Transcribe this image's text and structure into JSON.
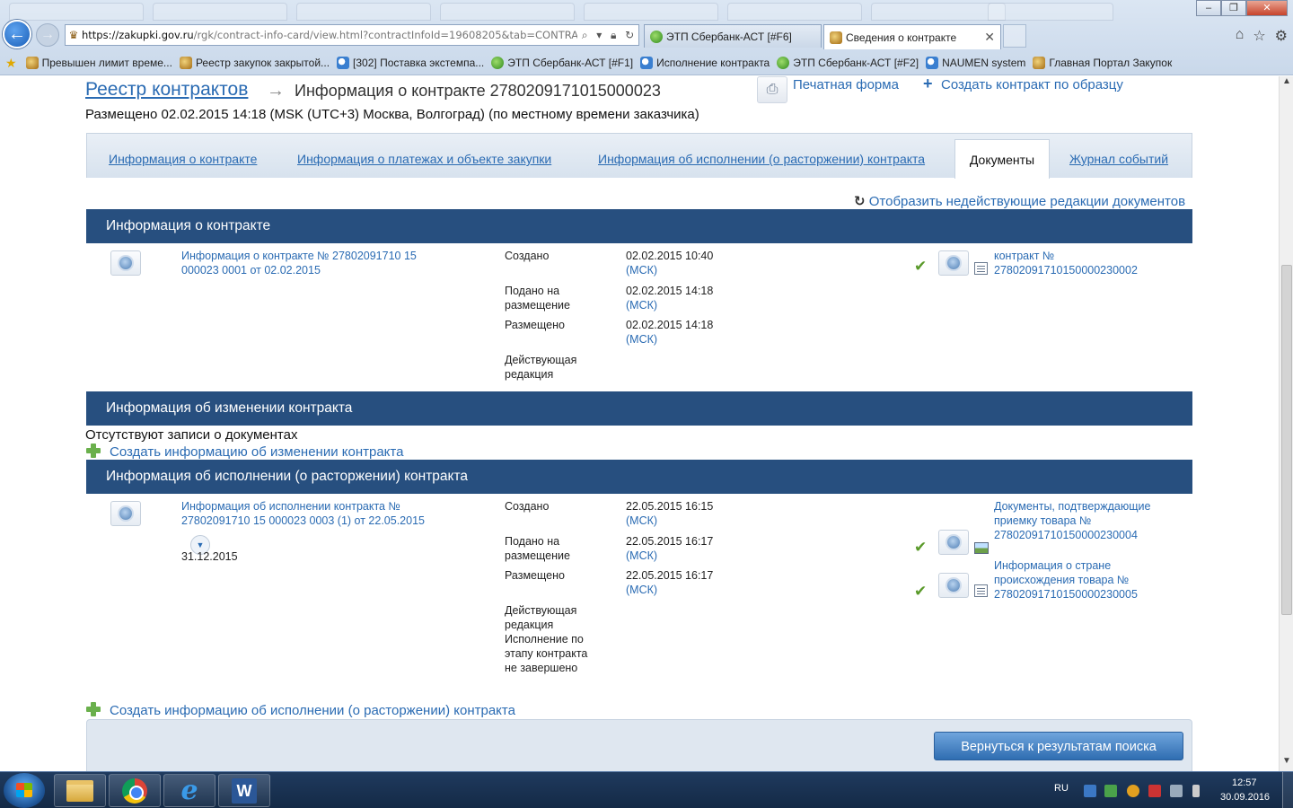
{
  "browser": {
    "url_domain": "https://zakupki.gov.ru",
    "url_path": "/rgk/contract-info-card/view.html?contractInfoId=19608205&tab=CONTRACT_I",
    "tabs": [
      {
        "label": "ЭТП Сбербанк-АСТ [#F6]",
        "icon": "green-globe-icon"
      },
      {
        "label": "Сведения о контракте",
        "icon": "eagle-emblem-icon",
        "active": true
      }
    ],
    "favorites": [
      "Превышен лимит време...",
      "Реестр закупок закрытой...",
      "[302] Поставка экстемпа...",
      "ЭТП Сбербанк-АСТ [#F1]",
      "Исполнение контракта",
      "ЭТП Сбербанк-АСТ [#F2]",
      "NAUMEN system",
      "Главная Портал Закупок"
    ]
  },
  "header": {
    "breadcrumb_root": "Реестр контрактов",
    "breadcrumb_current": "Информация о контракте 2780209171015000023",
    "print_label": "Печатная форма",
    "create_copy_label": "Создать контракт по образцу",
    "placement_info": "Размещено 02.02.2015 14:18 (MSK (UTC+3) Москва, Волгоград) (по местному времени заказчика)"
  },
  "tabs": {
    "contract_info": "Информация о контракте",
    "payments": "Информация о платежах и объекте закупки",
    "execution": "Информация об исполнении (о расторжении) контракта",
    "documents": "Документы",
    "journal": "Журнал событий"
  },
  "show_inactive_label": "Отобразить недействующие редакции документов",
  "sections": {
    "contract": {
      "title": "Информация о контракте",
      "doc_link": "Информация о контракте № 27802091710 15 000023 0001 от 02.02.2015",
      "rows": [
        {
          "label": "Создано",
          "value": "02.02.2015 10:40",
          "tz": "(МСК)"
        },
        {
          "label": "Подано на размещение",
          "value": "02.02.2015 14:18",
          "tz": "(МСК)"
        },
        {
          "label": "Размещено",
          "value": "02.02.2015 14:18",
          "tz": "(МСК)"
        },
        {
          "label": "Действующая редакция"
        }
      ],
      "attachment": "контракт № 27802091710150000230002"
    },
    "change": {
      "title": "Информация об изменении контракта",
      "empty_text": "Отсутствуют записи о документах",
      "create_link": "Создать информацию об изменении контракта"
    },
    "execution": {
      "title": "Информация об исполнении (о расторжении) контракта",
      "doc_link": "Информация об исполнении контракта № 27802091710 15 000023 0003 (1) от 22.05.2015",
      "date": "31.12.2015",
      "rows": [
        {
          "label": "Создано",
          "value": "22.05.2015 16:15",
          "tz": "(МСК)"
        },
        {
          "label": "Подано на размещение",
          "value": "22.05.2015 16:17",
          "tz": "(МСК)"
        },
        {
          "label": "Размещено",
          "value": "22.05.2015 16:17",
          "tz": "(МСК)"
        },
        {
          "label": "Действующая редакция Исполнение по этапу контракта не завершено"
        }
      ],
      "attachment_1": "Документы, подтверждающие приемку товара № 27802091710150000230004",
      "attachment_2": "Информация о стране происхождения товара № 27802091710150000230005",
      "create_link": "Создать информацию об исполнении (о расторжении) контракта"
    }
  },
  "back_to_results": "Вернуться к результатам поиска",
  "taskbar": {
    "language": "RU",
    "time": "12:57",
    "date": "30.09.2016"
  }
}
